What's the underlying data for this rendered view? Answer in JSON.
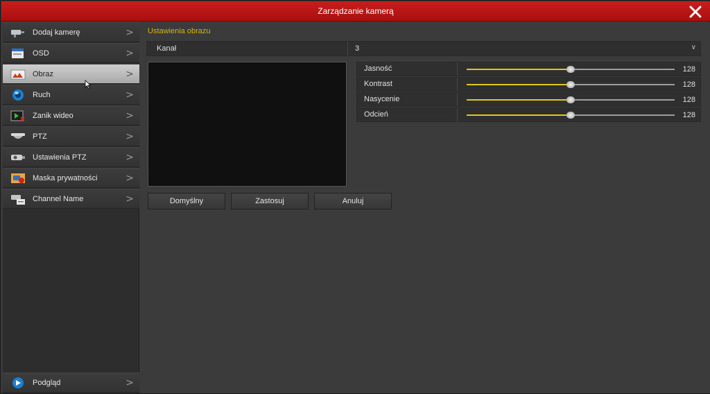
{
  "window": {
    "title": "Zarządzanie kamerą"
  },
  "sidebar": {
    "items": [
      {
        "label": "Dodaj kamerę",
        "icon": "camera-add-icon"
      },
      {
        "label": "OSD",
        "icon": "osd-icon"
      },
      {
        "label": "Obraz",
        "icon": "image-icon",
        "active": true
      },
      {
        "label": "Ruch",
        "icon": "motion-icon"
      },
      {
        "label": "Zanik wideo",
        "icon": "video-loss-icon"
      },
      {
        "label": "PTZ",
        "icon": "ptz-icon"
      },
      {
        "label": "Ustawienia PTZ",
        "icon": "ptz-settings-icon"
      },
      {
        "label": "Maska prywatności",
        "icon": "privacy-mask-icon"
      },
      {
        "label": "Channel Name",
        "icon": "channel-name-icon"
      }
    ],
    "footer": {
      "label": "Podgląd",
      "icon": "preview-icon"
    }
  },
  "main": {
    "section_title": "Ustawienia obrazu",
    "channel": {
      "label": "Kanał",
      "value": "3"
    },
    "sliders": [
      {
        "label": "Jasność",
        "value": "128",
        "level": 0.5
      },
      {
        "label": "Kontrast",
        "value": "128",
        "level": 0.5
      },
      {
        "label": "Nasycenie",
        "value": "128",
        "level": 0.5
      },
      {
        "label": "Odcień",
        "value": "128",
        "level": 0.5
      }
    ],
    "buttons": {
      "default": "Domyślny",
      "apply": "Zastosuj",
      "cancel": "Anuluj"
    }
  },
  "colors": {
    "title_bar": "#b51414",
    "accent": "#d6b312",
    "slider_fill": "#e0c71a"
  }
}
